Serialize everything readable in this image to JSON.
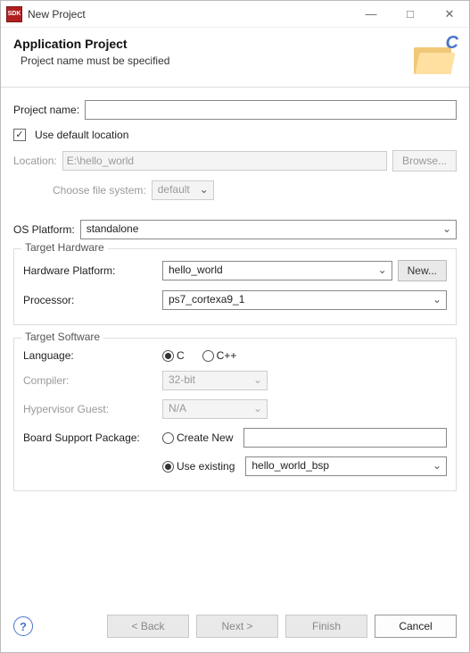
{
  "window": {
    "title": "New Project"
  },
  "header": {
    "title": "Application Project",
    "subtitle": "Project name must be specified"
  },
  "fields": {
    "project_name_label": "Project name:",
    "project_name_value": "",
    "use_default_label": "Use default location",
    "location_label": "Location:",
    "location_value": "E:\\hello_world",
    "browse_label": "Browse...",
    "file_system_label": "Choose file system:",
    "file_system_value": "default",
    "os_platform_label": "OS Platform:",
    "os_platform_value": "standalone"
  },
  "target_hw": {
    "group": "Target Hardware",
    "hp_label": "Hardware Platform:",
    "hp_value": "hello_world",
    "new_label": "New...",
    "proc_label": "Processor:",
    "proc_value": "ps7_cortexa9_1"
  },
  "target_sw": {
    "group": "Target Software",
    "lang_label": "Language:",
    "lang_c": "C",
    "lang_cpp": "C++",
    "compiler_label": "Compiler:",
    "compiler_value": "32-bit",
    "hv_label": "Hypervisor Guest:",
    "hv_value": "N/A",
    "bsp_label": "Board Support Package:",
    "bsp_create": "Create New",
    "bsp_create_value": "",
    "bsp_use": "Use existing",
    "bsp_use_value": "hello_world_bsp"
  },
  "footer": {
    "back": "< Back",
    "next": "Next >",
    "finish": "Finish",
    "cancel": "Cancel"
  }
}
